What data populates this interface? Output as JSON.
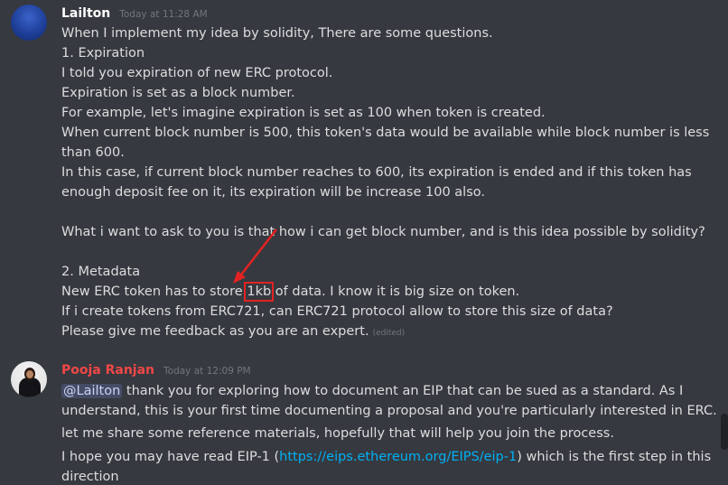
{
  "messages": [
    {
      "username": "Lailton",
      "timestamp": "Today at 11:28 AM",
      "lines": [
        "When I implement my idea by solidity, There are some questions.",
        "1. Expiration",
        "I told you expiration of new ERC protocol.",
        "Expiration is set as a block number.",
        "For example, let's imagine expiration is set as 100 when token is created.",
        "When current block number is 500, this token's data would be available while block number is less",
        "than 600.",
        "In this case, if current block number reaches to 600, its expiration is ended and if this token has",
        "enough deposit fee on it, its expiration will be increase 100 also.",
        "What i want to ask to you is that how i can get block number, and is this idea possible by solidity?",
        "2. Metadata",
        "",
        "If i create tokens from ERC721, can ERC721 protocol allow to store this size of data?",
        "Please give me feedback as you are an expert."
      ],
      "metadata_line": {
        "before": "New ERC token has to store ",
        "highlight": "1kb",
        "after": " of data. I know it is big size on token."
      },
      "edited_label": "(edited)"
    },
    {
      "username": "Pooja Ranjan",
      "timestamp": "Today at 12:09 PM",
      "mention": "@Lailton",
      "line1_rest": " thank you for exploring how to document an EIP that can be sued as a standard. As I",
      "line2": "understand, this is your first time documenting a proposal and you're particularly interested in ERC.",
      "line3": "let me share some reference materials, hopefully that will help you join the process.",
      "line4_before": "I hope you may have read EIP-1 (",
      "line4_link": "https://eips.ethereum.org/EIPS/eip-1",
      "line4_after": ") which is the first step in this",
      "line5": "direction"
    }
  ],
  "colors": {
    "background": "#36393f",
    "text": "#dcddde",
    "username_2": "#f04747",
    "link": "#00b0f4",
    "highlight_box": "#e32222"
  }
}
